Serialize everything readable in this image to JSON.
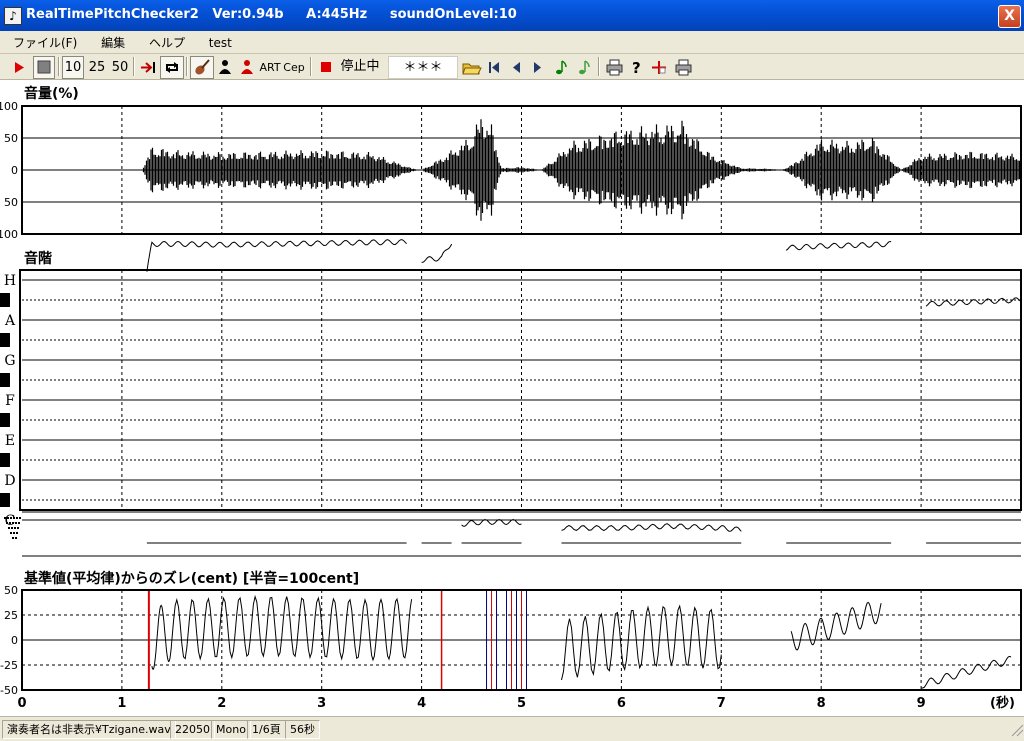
{
  "window": {
    "title": "RealTimePitchChecker2   Ver:0.94b     A:445Hz     soundOnLevel:10",
    "icon": "♪",
    "close_label": "X"
  },
  "menu": [
    "ファイル(F)",
    "編集",
    "ヘルプ",
    "test"
  ],
  "toolbar": {
    "speed_10": "10",
    "speed_25": "25",
    "speed_50": "50",
    "art_label": "ART",
    "cep_label": "Cep",
    "state_label": "停止中",
    "note_label": "＊＊＊"
  },
  "volume_panel": {
    "title": "音量(%)",
    "y_ticks": [
      "100",
      "50",
      "0",
      "50",
      "100"
    ]
  },
  "pitch_panel": {
    "title": "音階",
    "notes": [
      "H",
      "A",
      "G",
      "F",
      "E",
      "D",
      "C"
    ]
  },
  "cent_panel": {
    "title": "基準値(平均律)からのズレ(cent) [半音=100cent]",
    "y_ticks": [
      "50",
      "25",
      "0",
      "-25",
      "-50"
    ]
  },
  "time_axis": {
    "ticks": [
      "0",
      "1",
      "2",
      "3",
      "4",
      "5",
      "6",
      "7",
      "8",
      "9"
    ],
    "unit": "(秒)"
  },
  "status": [
    "演奏者名は非表示¥Tzigane.wav",
    "22050",
    "Mono",
    "1/6頁",
    "56秒"
  ],
  "colors": {
    "accent": "#0551d6",
    "stop": "#e00000",
    "marker": "#dd0000",
    "dev_line": "#000080"
  },
  "chart_data": [
    {
      "type": "area",
      "title": "音量(%)",
      "xlabel": "(秒)",
      "xlim": [
        0,
        10
      ],
      "ylim": [
        -100,
        100
      ],
      "x": [
        0,
        1.2,
        1.3,
        1.5,
        2.0,
        2.5,
        3.0,
        3.5,
        3.9,
        4.0,
        4.2,
        4.5,
        4.6,
        4.7,
        4.8,
        5.0,
        5.2,
        5.5,
        6.0,
        6.5,
        6.6,
        6.9,
        7.2,
        7.5,
        7.6,
        7.7,
        8.0,
        8.3,
        8.5,
        8.8,
        9.0,
        9.5,
        10.0
      ],
      "values": [
        0,
        0,
        38,
        32,
        28,
        30,
        32,
        28,
        3,
        0,
        20,
        55,
        92,
        72,
        3,
        5,
        0,
        45,
        65,
        75,
        80,
        25,
        3,
        2,
        0,
        8,
        50,
        45,
        55,
        0,
        25,
        30,
        25
      ]
    },
    {
      "type": "line",
      "title": "音階",
      "xlim": [
        0,
        10
      ],
      "y_categories": [
        "C",
        "D",
        "E",
        "F",
        "G",
        "A",
        "H"
      ],
      "series": [
        {
          "x": [
            1.25,
            1.3,
            1.6,
            2.0,
            2.5,
            3.0,
            3.5,
            3.85
          ],
          "values": [
            6.2,
            6.9,
            6.9,
            6.88,
            6.9,
            6.92,
            6.94,
            6.95
          ]
        },
        {
          "x": [
            4.0,
            4.2,
            4.3
          ],
          "values": [
            6.5,
            6.55,
            6.95
          ]
        },
        {
          "x": [
            4.4,
            4.6,
            5.0
          ],
          "values": [
            -0.1,
            -0.05,
            -0.05
          ]
        },
        {
          "x": [
            5.4,
            6.0,
            6.5,
            7.0,
            7.2
          ],
          "values": [
            -0.2,
            -0.2,
            -0.15,
            -0.2,
            -0.25
          ]
        },
        {
          "x": [
            7.65,
            8.0,
            8.5,
            8.7
          ],
          "values": [
            6.8,
            6.85,
            6.88,
            6.9
          ]
        },
        {
          "x": [
            9.05,
            9.5,
            10.0
          ],
          "values": [
            5.4,
            5.45,
            5.5
          ]
        }
      ]
    },
    {
      "type": "line",
      "title": "基準値(平均律)からのズレ(cent) [半音=100cent]",
      "xlabel": "(秒)",
      "xlim": [
        0,
        10
      ],
      "ylim": [
        -50,
        50
      ],
      "series": [
        {
          "x": [
            1.3,
            1.5,
            2.0,
            2.5,
            3.0,
            3.5,
            3.9
          ],
          "values": [
            0,
            10,
            12,
            14,
            12,
            10,
            12
          ]
        },
        {
          "x": [
            5.4,
            6.0,
            6.5,
            7.0
          ],
          "values": [
            -10,
            0,
            5,
            0
          ]
        },
        {
          "x": [
            7.7,
            8.0,
            8.3,
            8.6
          ],
          "values": [
            0,
            10,
            20,
            30
          ]
        },
        {
          "x": [
            9.0,
            9.5,
            9.9
          ],
          "values": [
            -45,
            -30,
            -20
          ]
        }
      ]
    }
  ]
}
